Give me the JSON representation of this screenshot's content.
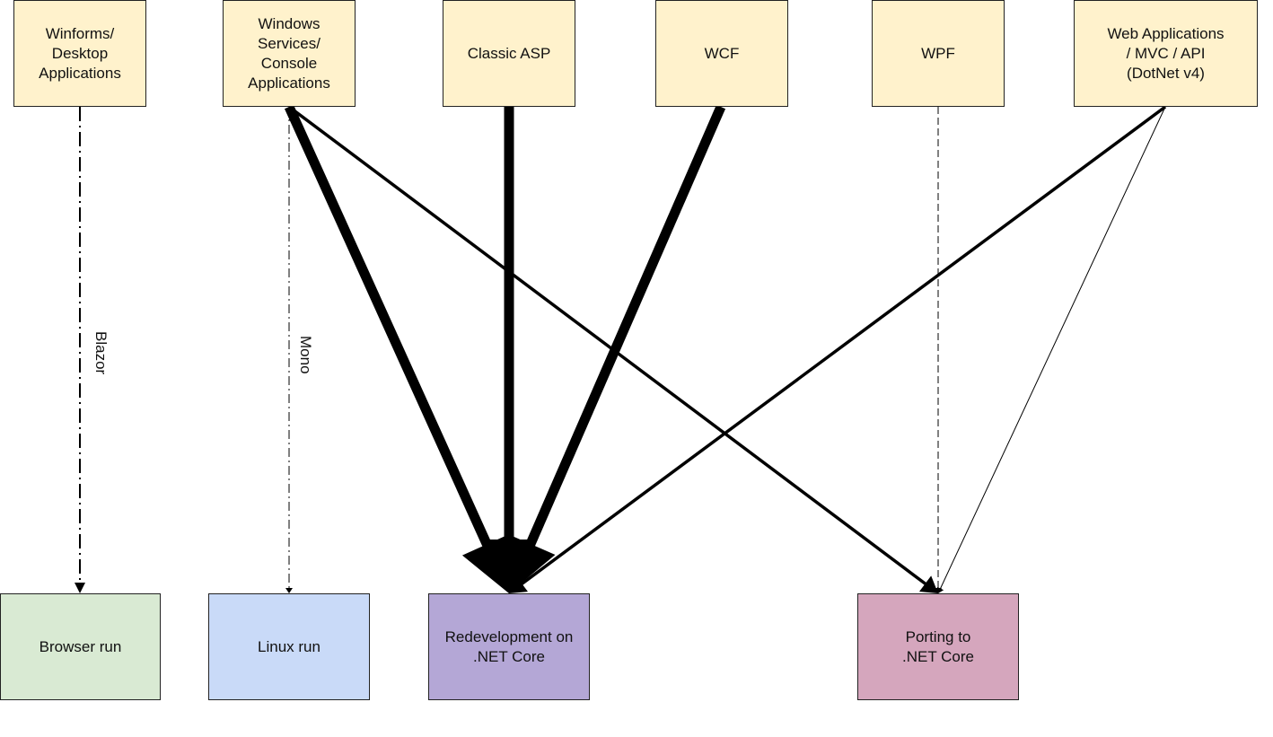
{
  "colors": {
    "source_fill": "#fff2cc",
    "browser_fill": "#d9ead3",
    "linux_fill": "#c9daf8",
    "redevelopment_fill": "#b4a7d6",
    "porting_fill": "#d5a6bd",
    "stroke": "#000000"
  },
  "sources": [
    {
      "id": "winforms",
      "label": "Winforms/\nDesktop\nApplications"
    },
    {
      "id": "winservices",
      "label": "Windows\nServices/\nConsole\nApplications"
    },
    {
      "id": "classicasp",
      "label": "Classic ASP"
    },
    {
      "id": "wcf",
      "label": "WCF"
    },
    {
      "id": "wpf",
      "label": "WPF"
    },
    {
      "id": "webapps",
      "label": "Web Applications\n/ MVC / API\n(DotNet v4)"
    }
  ],
  "targets": [
    {
      "id": "browser",
      "label": "Browser run"
    },
    {
      "id": "linux",
      "label": "Linux run"
    },
    {
      "id": "redevelopment",
      "label": "Redevelopment on\n.NET Core"
    },
    {
      "id": "porting",
      "label": "Porting to\n.NET Core"
    }
  ],
  "edges": [
    {
      "from": "winforms",
      "to": "browser",
      "style": "dash-dot",
      "weight": "thin",
      "label": "Blazor"
    },
    {
      "from": "winservices",
      "to": "linux",
      "style": "dash-dot",
      "weight": "hairline",
      "label": "Mono"
    },
    {
      "from": "winservices",
      "to": "redevelopment",
      "style": "solid",
      "weight": "heavy",
      "label": ""
    },
    {
      "from": "winservices",
      "to": "porting",
      "style": "solid",
      "weight": "medium",
      "label": ""
    },
    {
      "from": "classicasp",
      "to": "redevelopment",
      "style": "solid",
      "weight": "heavy",
      "label": ""
    },
    {
      "from": "wcf",
      "to": "redevelopment",
      "style": "solid",
      "weight": "heavy",
      "label": ""
    },
    {
      "from": "wpf",
      "to": "porting",
      "style": "dashed",
      "weight": "hairline",
      "label": ""
    },
    {
      "from": "webapps",
      "to": "redevelopment",
      "style": "solid",
      "weight": "medium",
      "label": ""
    },
    {
      "from": "webapps",
      "to": "porting",
      "style": "solid",
      "weight": "hairline",
      "label": ""
    }
  ]
}
